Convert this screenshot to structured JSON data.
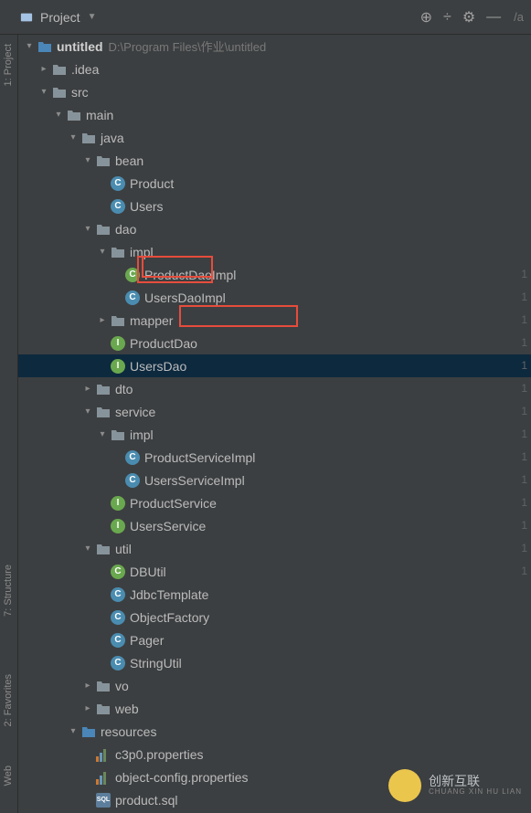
{
  "toolbar": {
    "title": "Project",
    "right_label": "/a"
  },
  "side": {
    "project": "1: Project",
    "structure": "7: Structure",
    "favorites": "2: Favorites",
    "web": "Web"
  },
  "tree": [
    {
      "depth": 0,
      "chev": "down",
      "icon": "folder-blue",
      "label": "untitled",
      "bold": true,
      "dim": "D:\\Program Files\\作业\\untitled"
    },
    {
      "depth": 1,
      "chev": "right",
      "icon": "folder",
      "label": ".idea"
    },
    {
      "depth": 1,
      "chev": "down",
      "icon": "folder",
      "label": "src"
    },
    {
      "depth": 2,
      "chev": "down",
      "icon": "folder",
      "label": "main"
    },
    {
      "depth": 3,
      "chev": "down",
      "icon": "folder",
      "label": "java"
    },
    {
      "depth": 4,
      "chev": "down",
      "icon": "folder",
      "label": "bean"
    },
    {
      "depth": 5,
      "chev": "",
      "icon": "class",
      "label": "Product"
    },
    {
      "depth": 5,
      "chev": "",
      "icon": "class",
      "label": "Users"
    },
    {
      "depth": 4,
      "chev": "down",
      "icon": "folder",
      "label": "dao"
    },
    {
      "depth": 5,
      "chev": "down",
      "icon": "folder",
      "label": "impl"
    },
    {
      "depth": 6,
      "chev": "",
      "icon": "class-g",
      "label": "ProductDaoImpl"
    },
    {
      "depth": 6,
      "chev": "",
      "icon": "class",
      "label": "UsersDaoImpl"
    },
    {
      "depth": 5,
      "chev": "right",
      "icon": "folder",
      "label": "mapper"
    },
    {
      "depth": 5,
      "chev": "",
      "icon": "interface",
      "label": "ProductDao"
    },
    {
      "depth": 5,
      "chev": "",
      "icon": "interface",
      "label": "UsersDao",
      "selected": true
    },
    {
      "depth": 4,
      "chev": "right",
      "icon": "folder",
      "label": "dto"
    },
    {
      "depth": 4,
      "chev": "down",
      "icon": "folder",
      "label": "service"
    },
    {
      "depth": 5,
      "chev": "down",
      "icon": "folder",
      "label": "impl"
    },
    {
      "depth": 6,
      "chev": "",
      "icon": "class",
      "label": "ProductServiceImpl"
    },
    {
      "depth": 6,
      "chev": "",
      "icon": "class",
      "label": "UsersServiceImpl"
    },
    {
      "depth": 5,
      "chev": "",
      "icon": "interface",
      "label": "ProductService"
    },
    {
      "depth": 5,
      "chev": "",
      "icon": "interface",
      "label": "UsersService"
    },
    {
      "depth": 4,
      "chev": "down",
      "icon": "folder",
      "label": "util"
    },
    {
      "depth": 5,
      "chev": "",
      "icon": "class-g",
      "label": "DBUtil"
    },
    {
      "depth": 5,
      "chev": "",
      "icon": "class",
      "label": "JdbcTemplate"
    },
    {
      "depth": 5,
      "chev": "",
      "icon": "class",
      "label": "ObjectFactory"
    },
    {
      "depth": 5,
      "chev": "",
      "icon": "class",
      "label": "Pager"
    },
    {
      "depth": 5,
      "chev": "",
      "icon": "class",
      "label": "StringUtil"
    },
    {
      "depth": 4,
      "chev": "right",
      "icon": "folder",
      "label": "vo"
    },
    {
      "depth": 4,
      "chev": "right",
      "icon": "folder",
      "label": "web"
    },
    {
      "depth": 3,
      "chev": "down",
      "icon": "folder-blue",
      "label": "resources"
    },
    {
      "depth": 4,
      "chev": "",
      "icon": "props",
      "label": "c3p0.properties"
    },
    {
      "depth": 4,
      "chev": "",
      "icon": "props",
      "label": "object-config.properties"
    },
    {
      "depth": 4,
      "chev": "",
      "icon": "sql",
      "label": "product.sql"
    }
  ],
  "line_numbers": [
    "1",
    "1",
    "1",
    "1",
    "1",
    "1",
    "1",
    "1",
    "1",
    "1",
    "1",
    "1",
    "1",
    "1"
  ],
  "watermark": {
    "main": "创新互联",
    "sub": "CHUANG XIN HU LIAN"
  }
}
